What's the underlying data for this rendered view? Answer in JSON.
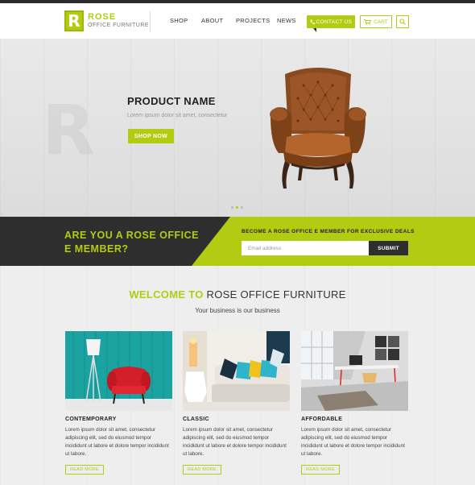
{
  "brand": {
    "mark": "R",
    "name": "ROSE",
    "tagline": "OFFICE FURNITURE",
    "accent_color": "#b3cc12",
    "dark_color": "#2e2e2e"
  },
  "nav": {
    "items": [
      {
        "label": "SHOP"
      },
      {
        "label": "ABOUT"
      },
      {
        "label": "PROJECTS"
      },
      {
        "label": "NEWS"
      }
    ],
    "contact_label": "CONTACT US",
    "cart_label": "CART",
    "cart_icon": "cart-icon",
    "search_icon": "search-icon"
  },
  "hero": {
    "watermark": "R",
    "product_name": "PRODUCT NAME",
    "description": "Lorem ipsum dolor sit amet, consectetur",
    "cta_label": "SHOP NOW",
    "slide_count": 3,
    "active_slide": 2
  },
  "member": {
    "question_line1": "ARE YOU A ROSE OFFICE",
    "question_line2": "E MEMBER?",
    "promo_title": "BECOME A ROSE OFFICE E MEMBER FOR EXCLUSIVE DEALS",
    "email_placeholder": "Email address",
    "submit_label": "SUBMIT"
  },
  "welcome": {
    "highlight": "WELCOME TO",
    "title_rest": " ROSE OFFICE FURNITURE",
    "subtitle": "Your business is our business"
  },
  "cards": [
    {
      "title": "CONTEMPORARY",
      "text": "Lorem ipsum dolor sit amet, consectetur adipiscing elit, sed do eiusmod tempor incididunt ut labore et dolore tempor incididunt ut labore.",
      "cta": "READ MORE"
    },
    {
      "title": "CLASSIC",
      "text": "Lorem ipsum dolor sit amet, consectetur adipiscing elit, sed do eiusmod tempor incididunt ut labore et dolore tempor incididunt ut labore.",
      "cta": "READ MORE"
    },
    {
      "title": "AFFORDABLE",
      "text": "Lorem ipsum dolor sit amet, consectetur adipiscing elit, sed do eiusmod tempor incididunt ut labore et dolore tempor incididunt ut labore.",
      "cta": "READ MORE"
    }
  ]
}
